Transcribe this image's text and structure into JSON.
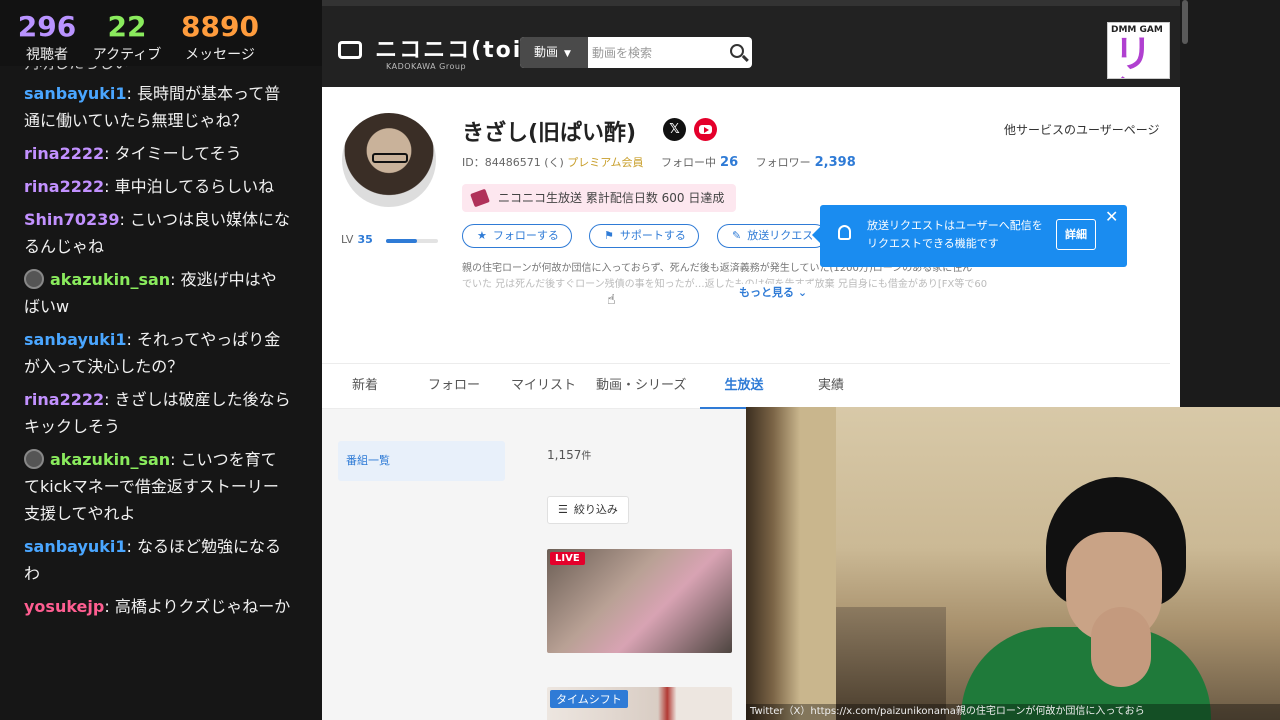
{
  "stats": {
    "viewers": {
      "value": "296",
      "label": "視聴者"
    },
    "active": {
      "value": "22",
      "label": "アクティブ"
    },
    "messages": {
      "value": "8890",
      "label": "メッセージ"
    }
  },
  "chat": {
    "partial_top": "判明したらしい",
    "messages": [
      {
        "user": "sanbayuki1",
        "text": "長時間が基本って普通に働いていたら無理じゃね？",
        "color": "#4aa6ff"
      },
      {
        "user": "rina2222",
        "text": "タイミーしてそう",
        "color": "#c291ff"
      },
      {
        "user": "rina2222",
        "text": "車中泊してるらしいね",
        "color": "#c291ff"
      },
      {
        "user": "Shin70239",
        "text": "こいつは良い媒体になるんじゃね",
        "color": "#c291ff"
      },
      {
        "user": "akazukin_san",
        "text": "夜逃げ中はやばいw",
        "color": "#8aeb5d",
        "avatar": true
      },
      {
        "user": "sanbayuki1",
        "text": "それってやっぱり金が入って決心したの？",
        "color": "#4aa6ff"
      },
      {
        "user": "rina2222",
        "text": "きざしは破産した後ならキックしそう",
        "color": "#c291ff"
      },
      {
        "user": "akazukin_san",
        "text": "こいつを育ててkickマネーで借金返すストーリー支援してやれよ",
        "color": "#8aeb5d",
        "avatar": true
      },
      {
        "user": "sanbayuki1",
        "text": "なるほど勉強になるわ",
        "color": "#4aa6ff"
      },
      {
        "user": "yosukejp",
        "text": "高橋よりクズじゃねーか",
        "color": "#ff5e91"
      }
    ]
  },
  "site": {
    "logo": "ニコニコ(toi)",
    "logo_sub": "KADOKAWA Group",
    "search_category": "動画",
    "search_placeholder": "動画を検索",
    "banner_top": "DMM GAM",
    "banner_big": "リン"
  },
  "profile": {
    "name": "きざし(旧ぱい酢)",
    "other_services": "他サービスのユーザーページ",
    "id_text": "ID：84486571 (く)",
    "premium": "プレミアム会員",
    "following_label": "フォロー中",
    "following": "26",
    "followers_label": "フォロワー",
    "followers": "2,398",
    "achievement": "ニコニコ生放送 累計配信日数 600 日達成",
    "level_label": "LV",
    "level": "35",
    "level_progress": 0.6,
    "buttons": {
      "follow": "フォローする",
      "support": "サポートする",
      "request": "放送リクエスト"
    },
    "description_line1": "親の住宅ローンが何故か団信に入っておらず、死んだ後も返済義務が発生していた(1200万)ローンのある家に住ん",
    "description_line2": "でいた 兄は死んだ後すぐローン残債の事を知ったが…返したものは何を告すず放棄 兄自身にも借金があり[FX等で60",
    "more": "もっと見る",
    "tooltip_text": "放送リクエストはユーザーへ配信をリクエストできる機能です",
    "tooltip_detail": "詳細"
  },
  "tabs": [
    "新着",
    "フォロー",
    "マイリスト",
    "動画・シリーズ",
    "生放送",
    "実績"
  ],
  "active_tab": "生放送",
  "content": {
    "side_item": "番組一覧",
    "count": "1,157",
    "count_unit": "件",
    "filter": "絞り込み",
    "live_badge": "LIVE",
    "timeshift_badge": "タイムシフト"
  },
  "webcam": {
    "caption": "Twitter（X）https://x.com/paizunikonama親の住宅ローンが何故か団信に入っておら"
  }
}
